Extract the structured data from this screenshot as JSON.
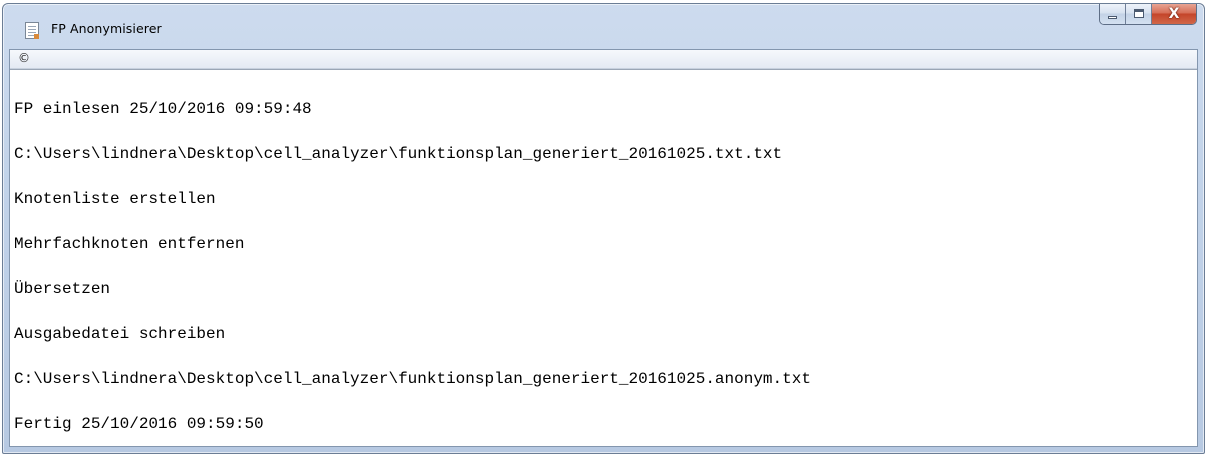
{
  "window": {
    "title": "FP Anonymisierer",
    "icon": "document-icon",
    "controls": {
      "minimize": "minimize-icon",
      "maximize": "maximize-icon",
      "close": "X"
    }
  },
  "menubar": {
    "items": [
      {
        "label": "©"
      }
    ]
  },
  "console": {
    "lines": [
      "FP einlesen 25/10/2016 09:59:48",
      "C:\\Users\\lindnera\\Desktop\\cell_analyzer\\funktionsplan_generiert_20161025.txt.txt",
      "Knotenliste erstellen",
      "Mehrfachknoten entfernen",
      "Übersetzen",
      "Ausgabedatei schreiben",
      "C:\\Users\\lindnera\\Desktop\\cell_analyzer\\funktionsplan_generiert_20161025.anonym.txt",
      "Fertig 25/10/2016 09:59:50"
    ]
  },
  "colors": {
    "titlebar": "#c3d4ea",
    "close_button": "#c4452a",
    "console_background": "#ffffff",
    "console_text": "#000000"
  }
}
